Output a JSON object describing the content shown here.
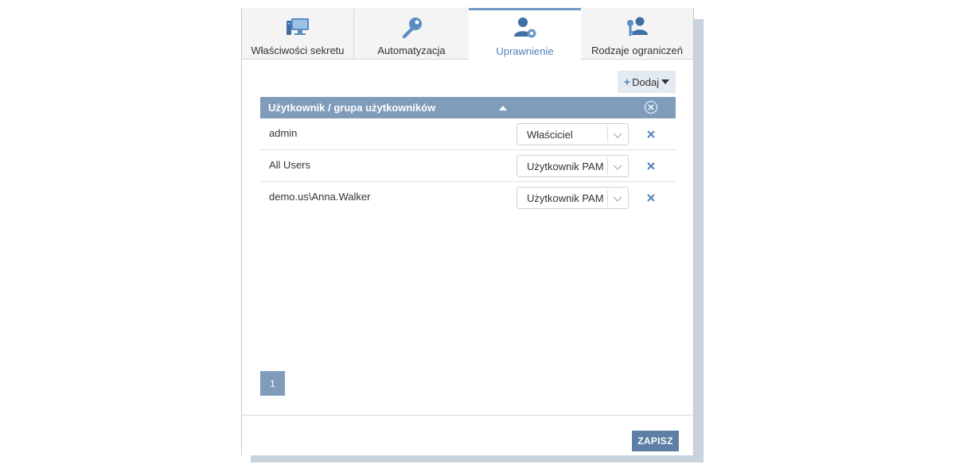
{
  "tabs": [
    {
      "label": "Właściwości sekretu",
      "icon": "computer-icon",
      "active": false
    },
    {
      "label": "Automatyzacja",
      "icon": "key-icon",
      "active": false
    },
    {
      "label": "Uprawnienie",
      "icon": "user-gear-icon",
      "active": true
    },
    {
      "label": "Rodzaje ograniczeń",
      "icon": "users-key-icon",
      "active": false
    }
  ],
  "toolbar": {
    "add_label": "Dodaj"
  },
  "grid": {
    "header": "Użytkownik / grupa użytkowników",
    "rows": [
      {
        "name": "admin",
        "role": "Właściciel"
      },
      {
        "name": "All Users",
        "role": "Użytkownik PAM"
      },
      {
        "name": "demo.us\\Anna.Walker",
        "role": "Użytkownik PAM"
      }
    ]
  },
  "pagination": {
    "current_page": "1"
  },
  "footer": {
    "save_label": "ZAPISZ"
  },
  "colors": {
    "accent": "#7f9cbb",
    "active_tab": "#4f82b8",
    "save": "#5d7fa5",
    "remove": "#4f82b8"
  }
}
